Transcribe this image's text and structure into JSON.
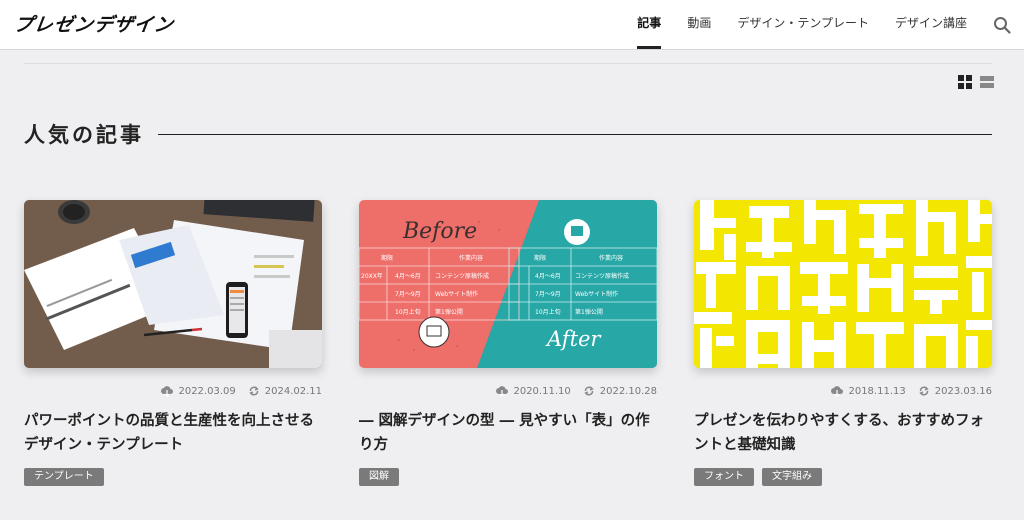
{
  "site": {
    "logo": "プレゼンデザイン"
  },
  "nav": {
    "items": [
      {
        "label": "記事",
        "active": true
      },
      {
        "label": "動画",
        "active": false
      },
      {
        "label": "デザイン・テンプレート",
        "active": false
      },
      {
        "label": "デザイン講座",
        "active": false
      }
    ],
    "search_icon": "search-icon"
  },
  "view_toggle": {
    "grid_icon": "grid-view-icon",
    "list_icon": "list-view-icon"
  },
  "section": {
    "title": "人気の記事"
  },
  "cards": [
    {
      "thumb_desc": "template-documents",
      "published": "2022.03.09",
      "updated": "2024.02.11",
      "title": "パワーポイントの品質と生産性を向上させるデザイン・テンプレート",
      "tags": [
        "テンプレート"
      ]
    },
    {
      "thumb_desc": "table-before-after",
      "thumb_text": {
        "before": "Before",
        "after": "After",
        "col1": "期限",
        "col2": "作業内容",
        "rows": [
          [
            "20XX年",
            "4月〜6月",
            "コンテンツ原稿作成"
          ],
          [
            "",
            "7月〜9月",
            "Webサイト制作"
          ],
          [
            "",
            "10月上旬",
            "第1弾公開"
          ]
        ]
      },
      "published": "2020.11.10",
      "updated": "2022.10.28",
      "title": "― 図解デザインの型 ― 見やすい「表」の作り方",
      "tags": [
        "図解"
      ]
    },
    {
      "thumb_desc": "font-typography",
      "published": "2018.11.13",
      "updated": "2023.03.16",
      "title": "プレゼンを伝わりやすくする、おすすめフォントと基礎知識",
      "tags": [
        "フォント",
        "文字組み"
      ]
    }
  ],
  "colors": {
    "background": "#efeff1",
    "tag_bg": "#7a7a7a",
    "coral": "#ee6e6a",
    "teal": "#27a7a6",
    "yellow": "#f3e600"
  }
}
